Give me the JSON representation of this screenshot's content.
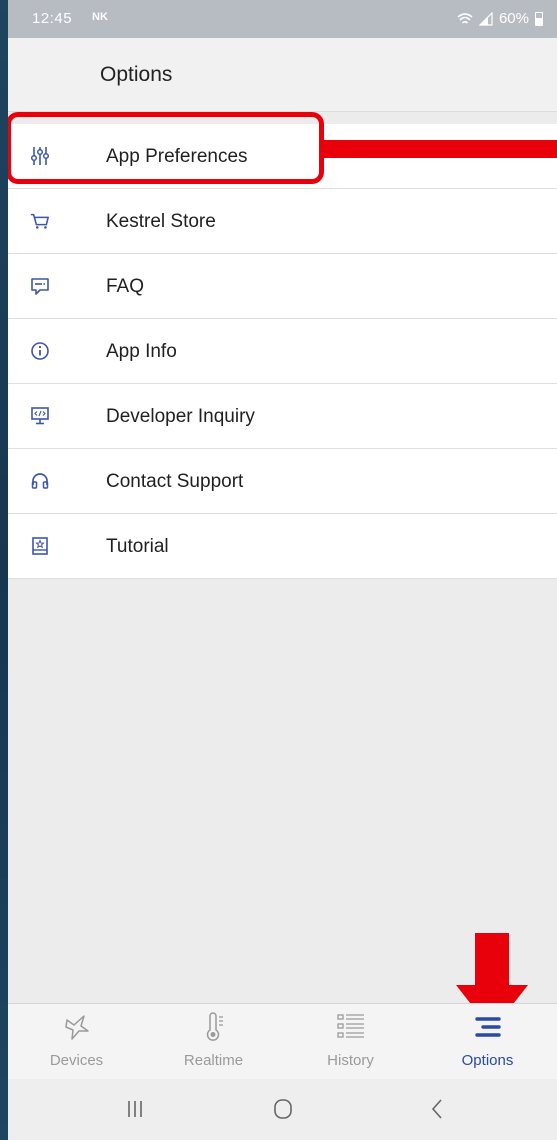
{
  "status_bar": {
    "time": "12:45",
    "carrier_badge": "NK",
    "battery": "60%"
  },
  "header": {
    "title": "Options"
  },
  "menu": {
    "items": [
      {
        "label": "App Preferences",
        "icon": "sliders-icon"
      },
      {
        "label": "Kestrel Store",
        "icon": "cart-icon"
      },
      {
        "label": "FAQ",
        "icon": "chat-icon"
      },
      {
        "label": "App Info",
        "icon": "info-icon"
      },
      {
        "label": "Developer Inquiry",
        "icon": "code-monitor-icon"
      },
      {
        "label": "Contact Support",
        "icon": "headset-icon"
      },
      {
        "label": "Tutorial",
        "icon": "book-icon"
      }
    ]
  },
  "tabs": [
    {
      "label": "Devices",
      "icon": "bird-icon",
      "active": false
    },
    {
      "label": "Realtime",
      "icon": "thermometer-icon",
      "active": false
    },
    {
      "label": "History",
      "icon": "list-icon",
      "active": false
    },
    {
      "label": "Options",
      "icon": "menu-icon",
      "active": true
    }
  ],
  "colors": {
    "accent": "#2a4aa6",
    "annotation": "#e8000b",
    "icon": "#3d56a8"
  }
}
